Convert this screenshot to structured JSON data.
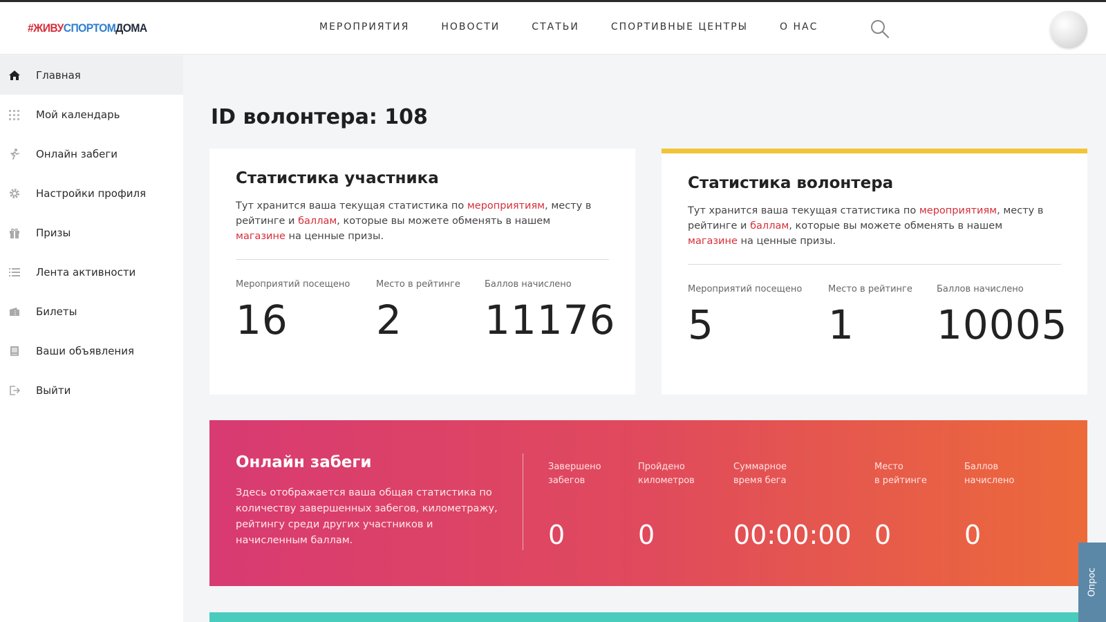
{
  "brand": {
    "part1": "#ЖИВУ",
    "part2": "СПОРТОМ",
    "part3": "ДОМА"
  },
  "topnav": [
    "Мероприятия",
    "Новости",
    "Статьи",
    "Спортивные центры",
    "О нас"
  ],
  "sidebar": {
    "items": [
      {
        "label": "Главная",
        "icon": "home-icon"
      },
      {
        "label": "Мой календарь",
        "icon": "calendar-icon"
      },
      {
        "label": "Онлайн забеги",
        "icon": "runner-icon"
      },
      {
        "label": "Настройки профиля",
        "icon": "gear-icon"
      },
      {
        "label": "Призы",
        "icon": "gift-icon"
      },
      {
        "label": "Лента активности",
        "icon": "list-icon"
      },
      {
        "label": "Билеты",
        "icon": "ticket-icon"
      },
      {
        "label": "Ваши объявления",
        "icon": "notepad-icon"
      },
      {
        "label": "Выйти",
        "icon": "logout-icon"
      }
    ]
  },
  "page": {
    "title": "ID волонтера: 108"
  },
  "participant_card": {
    "title": "Статистика участника",
    "desc_parts": [
      "Тут хранится ваша текущая статистика по ",
      "мероприятиям",
      ", месту в рейтинге и ",
      "баллам",
      ", которые вы можете обменять в нашем ",
      "магазине",
      " на ценные призы."
    ],
    "stats": [
      {
        "label": "Мероприятий посещено",
        "value": "16"
      },
      {
        "label": "Место в рейтинге",
        "value": "2"
      },
      {
        "label": "Баллов начислено",
        "value": "11176"
      }
    ]
  },
  "volunteer_card": {
    "title": "Статистика волонтера",
    "desc_parts": [
      "Тут хранится ваша текущая статистика по ",
      "мероприятиям",
      ", месту в рейтинге и ",
      "баллам",
      ", которые вы можете обменять в нашем ",
      "магазине",
      " на ценные призы."
    ],
    "stats": [
      {
        "label": "Мероприятий посещено",
        "value": "5"
      },
      {
        "label": "Место в рейтинге",
        "value": "1"
      },
      {
        "label": "Баллов начислено",
        "value": "10005"
      }
    ]
  },
  "online_runs": {
    "title": "Онлайн забеги",
    "desc": "Здесь отображается ваша общая статистика по количеству завершенных забегов, километражу, рейтингу среди других участников и начисленным баллам.",
    "stats": [
      {
        "label": "Завершено\nзабегов",
        "value": "0"
      },
      {
        "label": "Пройдено\nкилометров",
        "value": "0"
      },
      {
        "label": "Суммарное\nвремя бега",
        "value": "00:00:00"
      },
      {
        "label": "Место\nв рейтинге",
        "value": "0"
      },
      {
        "label": "Баллов\nначислено",
        "value": "0"
      }
    ]
  },
  "poll_tab": {
    "label": "Опрос"
  },
  "colors": {
    "accent_red": "#d62f3a",
    "accent_blue": "#2f7fd0",
    "volunteer_border": "#f2c437",
    "runs_gradient_start": "#d83a72",
    "runs_gradient_end": "#ec6a3a",
    "teal": "#49cbbd"
  }
}
